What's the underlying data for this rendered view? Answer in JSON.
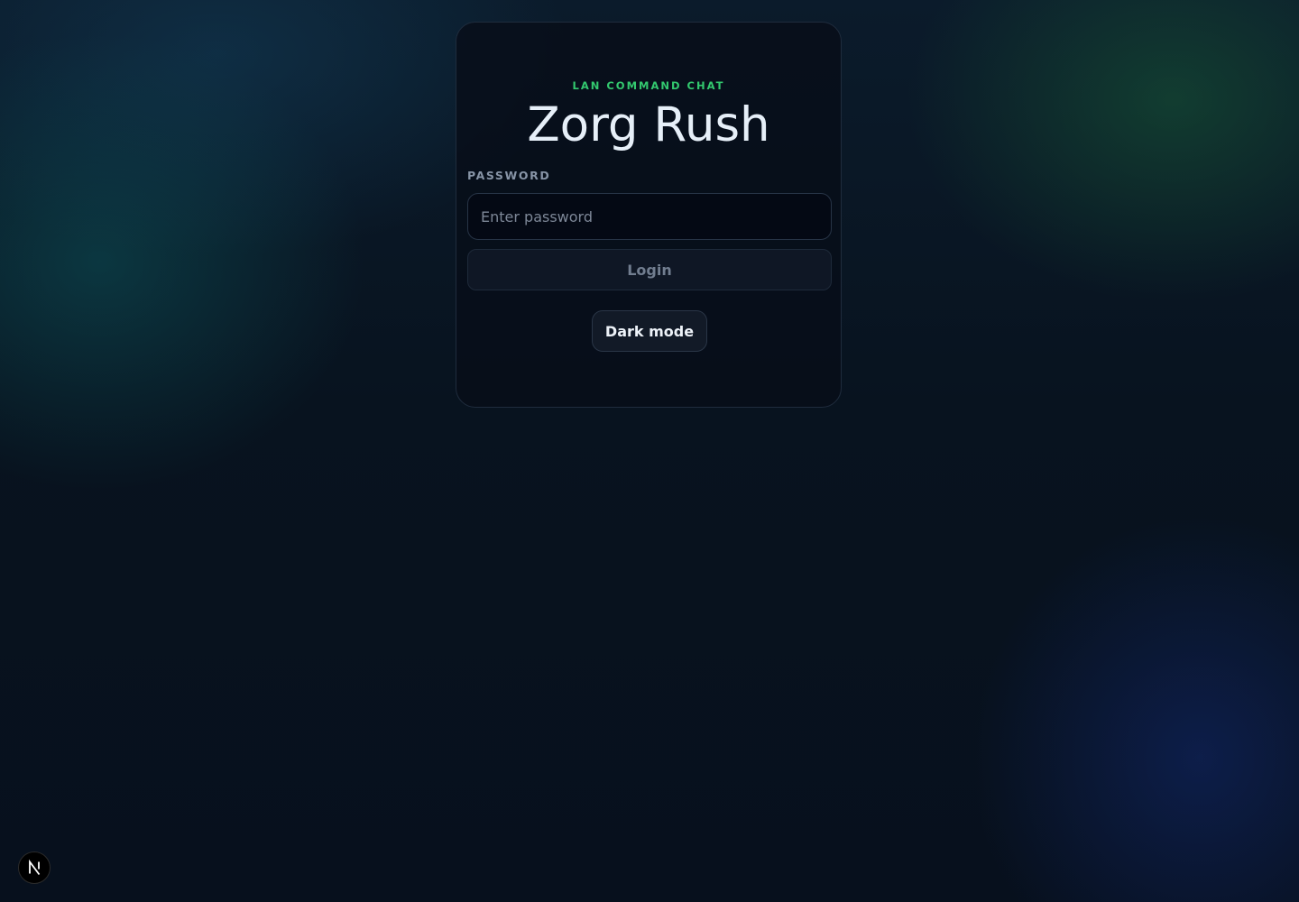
{
  "login_card": {
    "eyebrow": "LAN COMMAND CHAT",
    "title": "Zorg Rush",
    "password_label": "PASSWORD",
    "password_placeholder": "Enter password",
    "password_value": "",
    "login_button_label": "Login",
    "dark_mode_button_label": "Dark mode"
  },
  "dev_indicator": {
    "icon": "nextjs-logo-icon"
  },
  "colors": {
    "accent_green": "#33c96f",
    "background": "#07101f",
    "title_text": "#e6eff8"
  }
}
